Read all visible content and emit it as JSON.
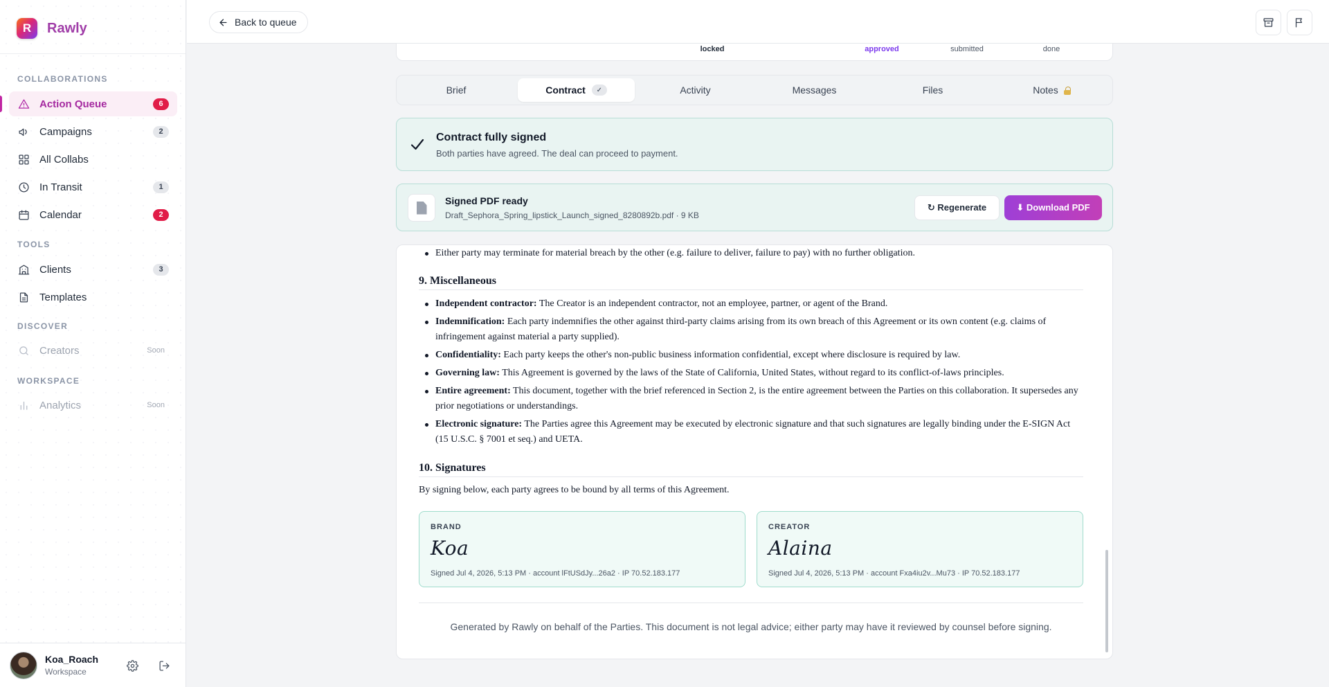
{
  "app": {
    "name": "Rawly",
    "logo_letter": "R"
  },
  "sidebar": {
    "sections": [
      {
        "label": "COLLABORATIONS"
      },
      {
        "label": "TOOLS"
      },
      {
        "label": "DISCOVER"
      },
      {
        "label": "WORKSPACE"
      }
    ],
    "items": [
      {
        "label": "Action Queue",
        "badge": "6",
        "icon": "warning-triangle-icon"
      },
      {
        "label": "Campaigns",
        "badge": "2",
        "icon": "megaphone-icon"
      },
      {
        "label": "All Collabs",
        "badge": "",
        "icon": "grid-icon"
      },
      {
        "label": "In Transit",
        "badge": "1",
        "icon": "clock-icon"
      },
      {
        "label": "Calendar",
        "badge": "2",
        "icon": "calendar-icon"
      },
      {
        "label": "Clients",
        "badge": "3",
        "icon": "building-icon"
      },
      {
        "label": "Templates",
        "badge": "",
        "icon": "document-icon"
      },
      {
        "label": "Creators",
        "badge": "Soon",
        "icon": "search-icon"
      },
      {
        "label": "Analytics",
        "badge": "Soon",
        "icon": "bar-chart-icon"
      }
    ],
    "user": {
      "name": "Koa_Roach",
      "workspace": "Workspace"
    }
  },
  "topbar": {
    "back_label": "Back to queue"
  },
  "stepper": {
    "labels": [
      "locked",
      "approved",
      "submitted",
      "done"
    ]
  },
  "tabs": [
    {
      "label": "Brief"
    },
    {
      "label": "Contract",
      "check": "✓"
    },
    {
      "label": "Activity"
    },
    {
      "label": "Messages"
    },
    {
      "label": "Files"
    },
    {
      "label": "Notes"
    }
  ],
  "banner": {
    "title": "Contract fully signed",
    "subtitle": "Both parties have agreed. The deal can proceed to payment."
  },
  "pdf": {
    "title": "Signed PDF ready",
    "filename": "Draft_Sephora_Spring_lipstick_Launch_signed_8280892b.pdf · 9 KB",
    "regenerate_label": "↻ Regenerate",
    "download_label": "⬇ Download PDF"
  },
  "contract": {
    "termination_bullet": "Either party may terminate for material breach by the other (e.g. failure to deliver, failure to pay) with no further obligation.",
    "section9_title": "9. Miscellaneous",
    "section9_items": [
      {
        "term": "Independent contractor:",
        "text": " The Creator is an independent contractor, not an employee, partner, or agent of the Brand."
      },
      {
        "term": "Indemnification:",
        "text": " Each party indemnifies the other against third-party claims arising from its own breach of this Agreement or its own content (e.g. claims of infringement against material a party supplied)."
      },
      {
        "term": "Confidentiality:",
        "text": " Each party keeps the other's non-public business information confidential, except where disclosure is required by law."
      },
      {
        "term": "Governing law:",
        "text": " This Agreement is governed by the laws of the State of California, United States, without regard to its conflict-of-laws principles."
      },
      {
        "term": "Entire agreement:",
        "text": " This document, together with the brief referenced in Section 2, is the entire agreement between the Parties on this collaboration. It supersedes any prior negotiations or understandings."
      },
      {
        "term": "Electronic signature:",
        "text": " The Parties agree this Agreement may be executed by electronic signature and that such signatures are legally binding under the E-SIGN Act (15 U.S.C. § 7001 et seq.) and UETA."
      }
    ],
    "section10_title": "10. Signatures",
    "section10_intro": "By signing below, each party agrees to be bound by all terms of this Agreement.",
    "signatures": [
      {
        "role": "BRAND",
        "name": "Koa",
        "meta": "Signed Jul 4, 2026, 5:13 PM · account lFtUSdJy...26a2 · IP 70.52.183.177"
      },
      {
        "role": "CREATOR",
        "name": "Alaina",
        "meta": "Signed Jul 4, 2026, 5:13 PM · account Fxa4iu2v...Mu73 · IP 70.52.183.177"
      }
    ],
    "footer": "Generated by Rawly on behalf of the Parties. This document is not legal advice; either party may have it reviewed by counsel before signing."
  },
  "colors": {
    "accent": "#a52aa0",
    "badge_red": "#e11d48",
    "success_bg": "#e9f4f2",
    "signature_border": "#9fdccc"
  }
}
